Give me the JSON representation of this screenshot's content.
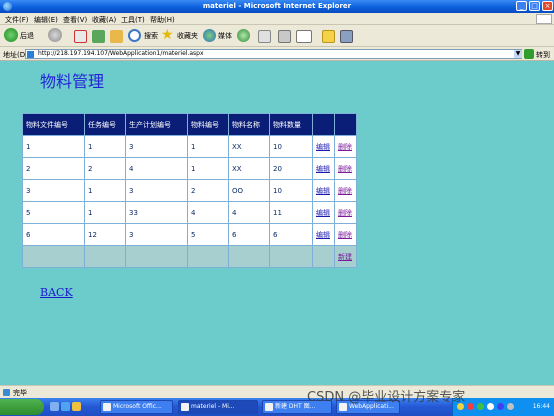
{
  "window": {
    "title": "materiel - Microsoft Internet Explorer",
    "controls": {
      "minimize": "_",
      "maximize": "□",
      "close": "×"
    }
  },
  "menu": [
    "文件(F)",
    "编辑(E)",
    "查看(V)",
    "收藏(A)",
    "工具(T)",
    "帮助(H)"
  ],
  "toolbar": {
    "back": "后退",
    "search": "搜索",
    "favorites": "收藏夹",
    "media": "媒体"
  },
  "address": {
    "label": "地址(D)",
    "url": "http://218.197.194.107/WebApplication1/materiel.aspx",
    "go": "转到"
  },
  "page": {
    "title": "物料管理",
    "back_link": "BACK"
  },
  "grid": {
    "headers": [
      "物料文件编号",
      "任务编号",
      "生产计划编号",
      "物料编号",
      "物料名称",
      "物料数量",
      "",
      ""
    ],
    "rows": [
      [
        "1",
        "1",
        "3",
        "1",
        "XX",
        "10",
        "编辑",
        "删除"
      ],
      [
        "2",
        "2",
        "4",
        "1",
        "XX",
        "20",
        "编辑",
        "删除"
      ],
      [
        "3",
        "1",
        "3",
        "2",
        "OO",
        "10",
        "编辑",
        "删除"
      ],
      [
        "5",
        "1",
        "33",
        "4",
        "4",
        "11",
        "编辑",
        "删除"
      ],
      [
        "6",
        "12",
        "3",
        "5",
        "6",
        "6",
        "编辑",
        "删除"
      ]
    ],
    "new_label": "新建"
  },
  "status": {
    "text": "完毕"
  },
  "taskbar": {
    "tasks": [
      "Microsoft Offic...",
      "materiel - Mi...",
      "新建 DHT 图...",
      "WebApplicati..."
    ],
    "clock": "16:44"
  },
  "watermark": "CSDN @毕业设计方案专家"
}
